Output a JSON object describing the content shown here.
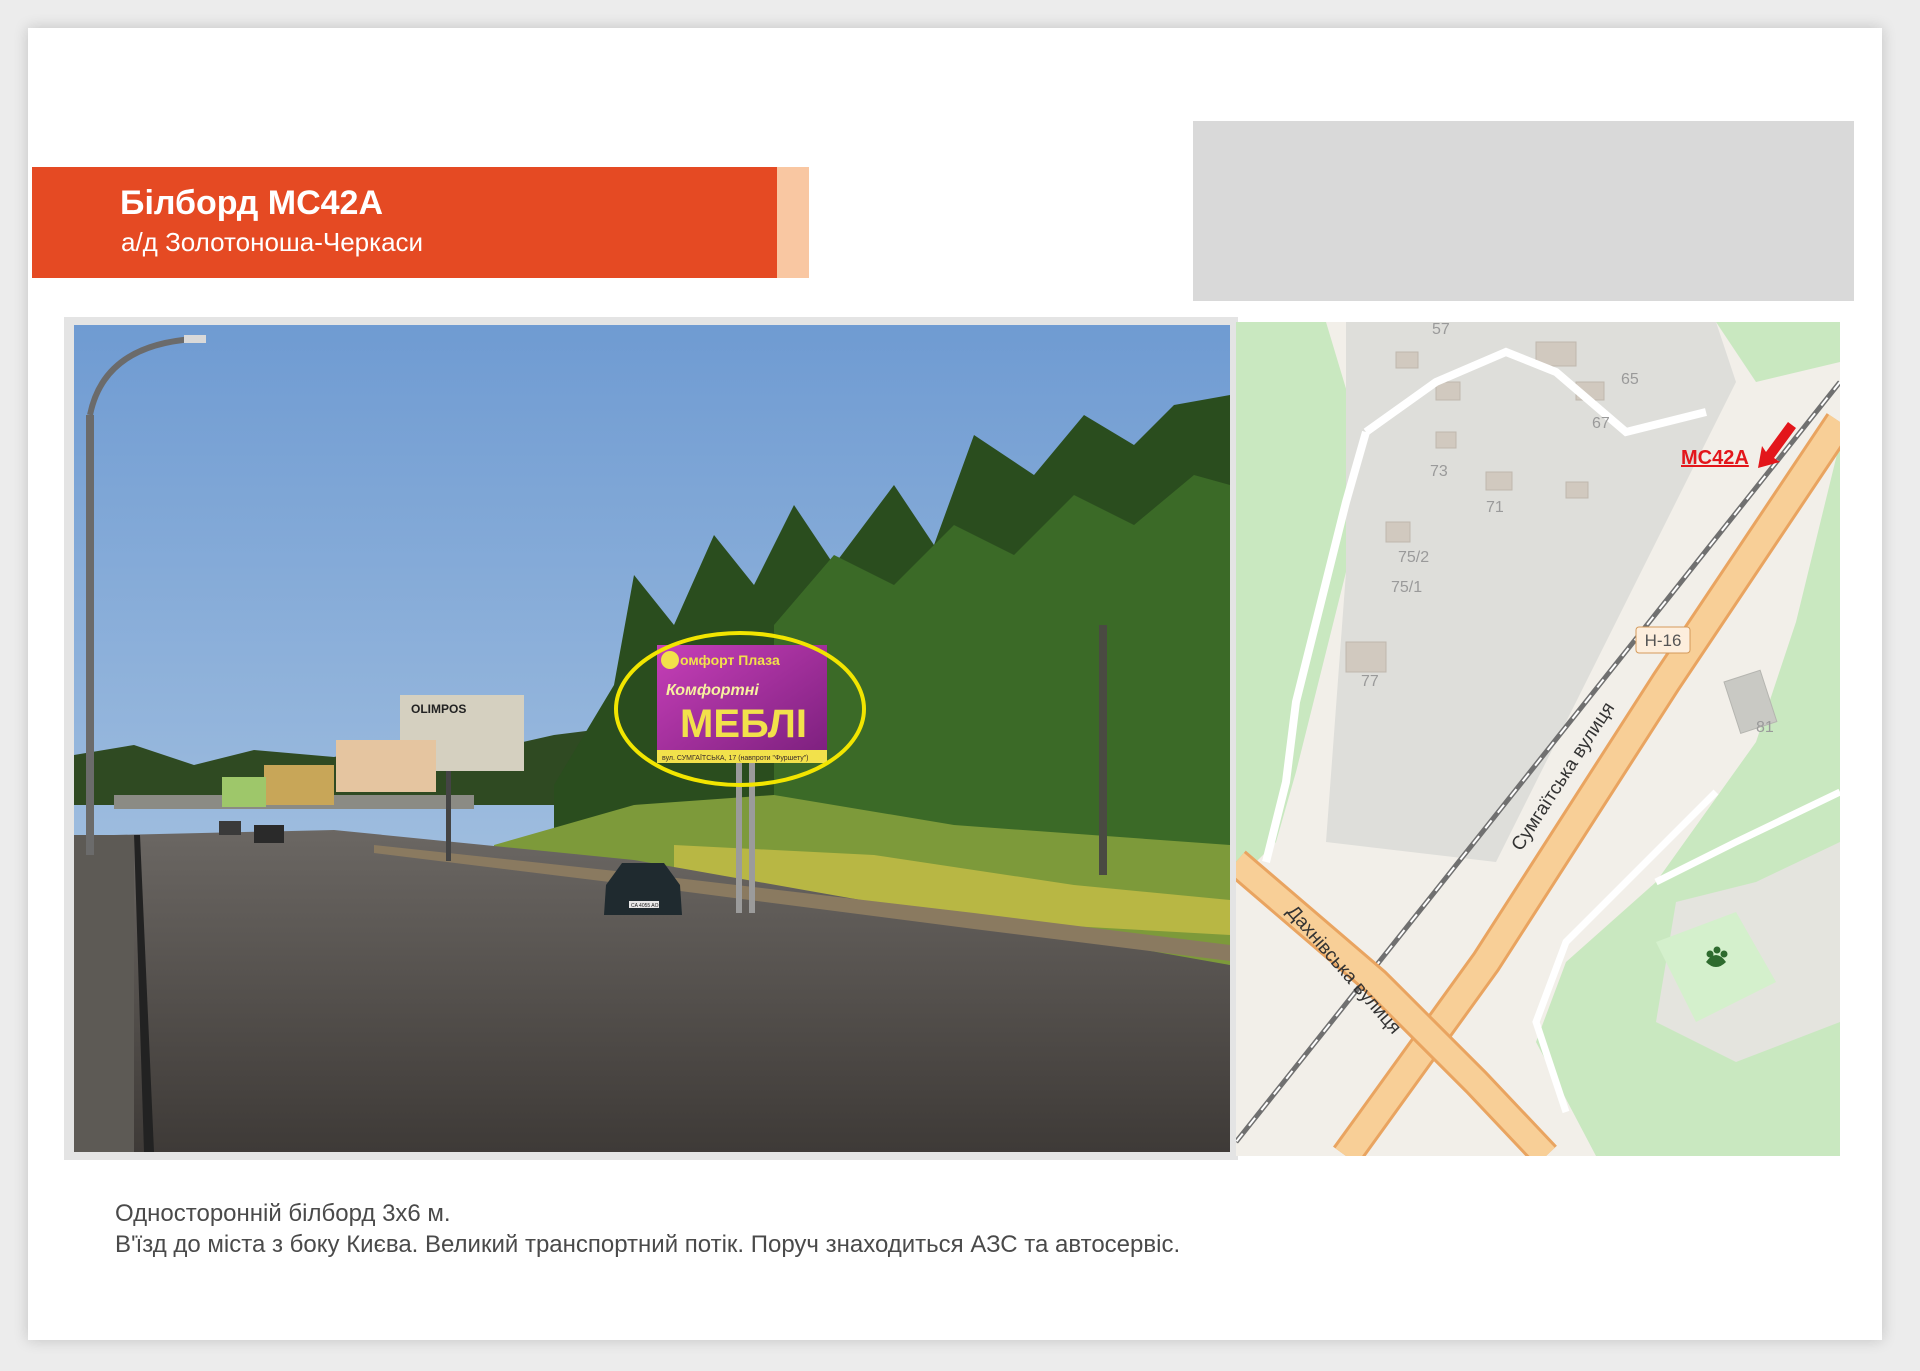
{
  "header": {
    "title": "Білборд MC42A",
    "subtitle": "а/д Золотоноша-Черкаси"
  },
  "photo": {
    "billboard_brand": "омфорт Плаза",
    "billboard_line1": "Комфортні",
    "billboard_line2": "МЕБЛІ",
    "billboard_address": "вул. СУМГАЇТСЬКА, 17 (навпроти \"Фуршету\")",
    "background_billboard": "OLIMPOS",
    "car_plate": "CA 4055 AO",
    "highlight_color": "#f2e500"
  },
  "map": {
    "marker_label": "MC42A",
    "marker_color": "#e3161b",
    "road_badge": "Н-16",
    "street_main": "Сумгаїтська вулиця",
    "street_cross": "Дахнівська вулиця",
    "house_numbers": [
      "57",
      "65",
      "67",
      "73",
      "71",
      "75/2",
      "75/1",
      "77",
      "81"
    ],
    "icon": "paw-icon"
  },
  "description": {
    "line1": "Односторонній білборд 3х6 м.",
    "line2": "В'їзд до міста з боку Києва. Великий транспортний потік. Поруч знаходиться АЗС та автосервіс."
  }
}
